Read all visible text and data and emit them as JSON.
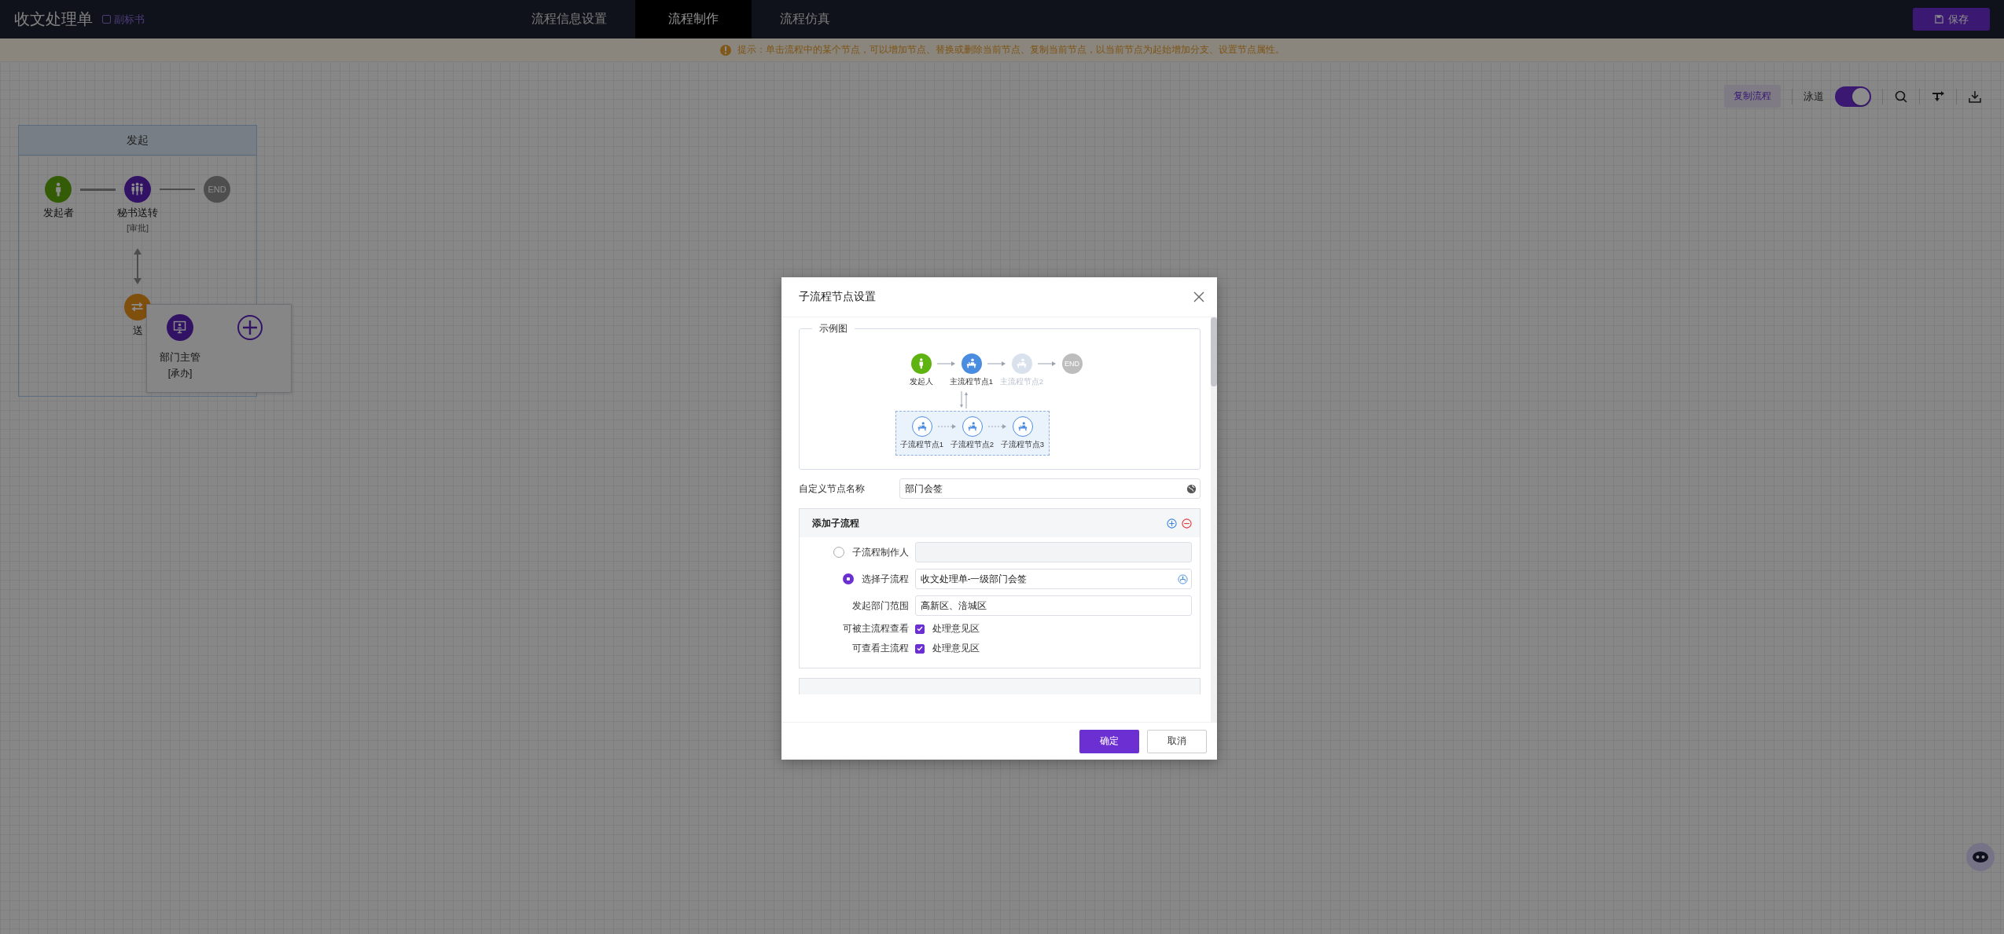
{
  "header": {
    "title": "收文处理单",
    "doc_link": "副标书",
    "tabs": [
      {
        "label": "流程信息设置",
        "selected": false
      },
      {
        "label": "流程制作",
        "selected": true
      },
      {
        "label": "流程仿真",
        "selected": false
      }
    ],
    "save_button": "保存"
  },
  "hint_bar": {
    "text": "提示：单击流程中的某个节点，可以增加节点、替换或删除当前节点、复制当前节点，以当前节点为起始增加分支、设置节点属性。"
  },
  "toolbar": {
    "copy_button": "复制流程",
    "swimlane": {
      "label": "泳道",
      "on": true
    }
  },
  "lane": {
    "title": "发起",
    "nodes": [
      {
        "kind": "start",
        "label": "发起者"
      },
      {
        "kind": "group",
        "label": "秘书送转",
        "sublabel": "[审批]"
      },
      {
        "kind": "end",
        "label": "END"
      }
    ],
    "branch_node": {
      "label": "送"
    },
    "popup": {
      "label": "部门主管",
      "sublabel": "[承办]"
    }
  },
  "dialog": {
    "title": "子流程节点设置",
    "example": {
      "legend": "示例图",
      "main_nodes": [
        {
          "kind": "start",
          "label": "发起人"
        },
        {
          "kind": "active",
          "label": "主流程节点1"
        },
        {
          "kind": "inactive",
          "label": "主流程节点2"
        },
        {
          "kind": "end",
          "label": "END"
        }
      ],
      "sub_nodes": [
        {
          "label": "子流程节点1"
        },
        {
          "label": "子流程节点2"
        },
        {
          "label": "子流程节点3"
        }
      ]
    },
    "name_field": {
      "label": "自定义节点名称",
      "value": "部门会签"
    },
    "subflow": {
      "title": "添加子流程",
      "options": [
        {
          "label": "子流程制作人",
          "selected": false
        },
        {
          "label": "选择子流程",
          "selected": true,
          "value": "收文处理单-一级部门会签"
        }
      ],
      "dept_range": {
        "label": "发起部门范围",
        "value": "高新区、涪城区"
      },
      "checks": [
        {
          "label": "可被主流程查看",
          "option": "处理意见区",
          "checked": true
        },
        {
          "label": "可查看主流程",
          "option": "处理意见区",
          "checked": true
        }
      ]
    },
    "buttons": {
      "confirm": "确定",
      "cancel": "取消"
    }
  }
}
